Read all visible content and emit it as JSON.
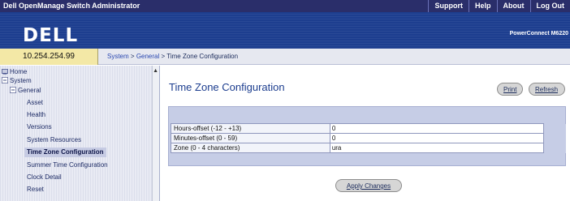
{
  "topbar": {
    "title": "Dell OpenManage Switch Administrator",
    "links": [
      "Support",
      "Help",
      "About",
      "Log Out"
    ]
  },
  "brand": {
    "logo": "DELL",
    "product": "PowerConnect M6220"
  },
  "address": "10.254.254.99",
  "breadcrumb": {
    "items": [
      "System",
      "General"
    ],
    "sep": ">",
    "current": "Time Zone Configuration"
  },
  "sidebar": {
    "items": [
      {
        "label": "Home",
        "icon": "home-icon"
      },
      {
        "label": "System",
        "icon": "collapse-icon"
      },
      {
        "label": "General",
        "icon": "collapse-icon"
      },
      {
        "label": "Asset"
      },
      {
        "label": "Health"
      },
      {
        "label": "Versions"
      },
      {
        "label": "System Resources"
      },
      {
        "label": "Time Zone Configuration",
        "active": true
      },
      {
        "label": "Summer Time Configuration"
      },
      {
        "label": "Clock Detail"
      },
      {
        "label": "Reset"
      }
    ]
  },
  "page": {
    "title": "Time Zone Configuration",
    "print_label": "Print",
    "refresh_label": "Refresh",
    "apply_label": "Apply Changes"
  },
  "form": {
    "fields": [
      {
        "label": "Hours-offset (-12 - +13)",
        "value": "0"
      },
      {
        "label": "Minutes-offset (0 - 59)",
        "value": "0"
      },
      {
        "label": "Zone (0 - 4 characters)",
        "value": "ura"
      }
    ]
  },
  "colors": {
    "topbar": "#2a2e6a",
    "brandbar": "#1d3e8f",
    "address_bg": "#f3e8a6",
    "form_panel": "#c6cde6"
  }
}
